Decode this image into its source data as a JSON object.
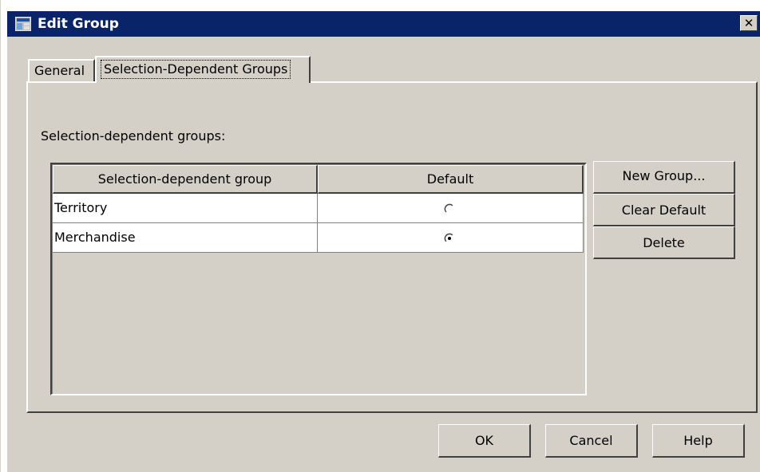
{
  "window": {
    "title": "Edit Group",
    "icon": "edit-group-app-icon",
    "close_glyph": "✕"
  },
  "tabs": [
    {
      "label": "General",
      "selected": false
    },
    {
      "label": "Selection-Dependent Groups",
      "selected": true
    }
  ],
  "panel": {
    "label": "Selection-dependent groups:",
    "table": {
      "columns": [
        "Selection-dependent group",
        "Default"
      ],
      "rows": [
        {
          "name": "Territory",
          "default": false
        },
        {
          "name": "Merchandise",
          "default": true
        }
      ]
    },
    "buttons": {
      "new_group": "New Group...",
      "clear_default": "Clear Default",
      "delete": "Delete"
    }
  },
  "footer": {
    "ok": "OK",
    "cancel": "Cancel",
    "help": "Help"
  },
  "colors": {
    "face": "#d4d0c8",
    "titlebar": "#0a246a",
    "titlebar_text": "#ffffff"
  }
}
